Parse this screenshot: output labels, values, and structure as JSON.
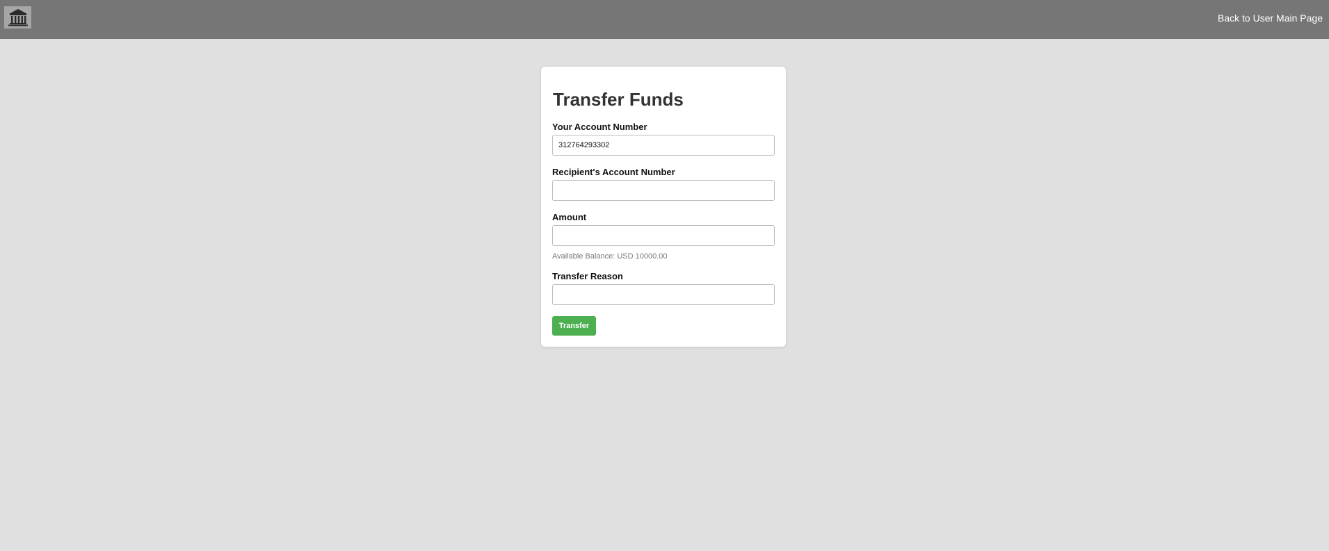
{
  "header": {
    "logo_icon": "bank-building-icon",
    "back_link_label": "Back to User Main Page"
  },
  "form": {
    "title": "Transfer Funds",
    "your_account": {
      "label": "Your Account Number",
      "value": "312764293302"
    },
    "recipient_account": {
      "label": "Recipient's Account Number",
      "value": ""
    },
    "amount": {
      "label": "Amount",
      "value": ""
    },
    "available_balance": "Available Balance: USD 10000.00",
    "transfer_reason": {
      "label": "Transfer Reason",
      "value": ""
    },
    "submit_label": "Transfer"
  },
  "colors": {
    "topbar": "#767676",
    "background": "#e0e0e0",
    "button": "#4caf50"
  }
}
